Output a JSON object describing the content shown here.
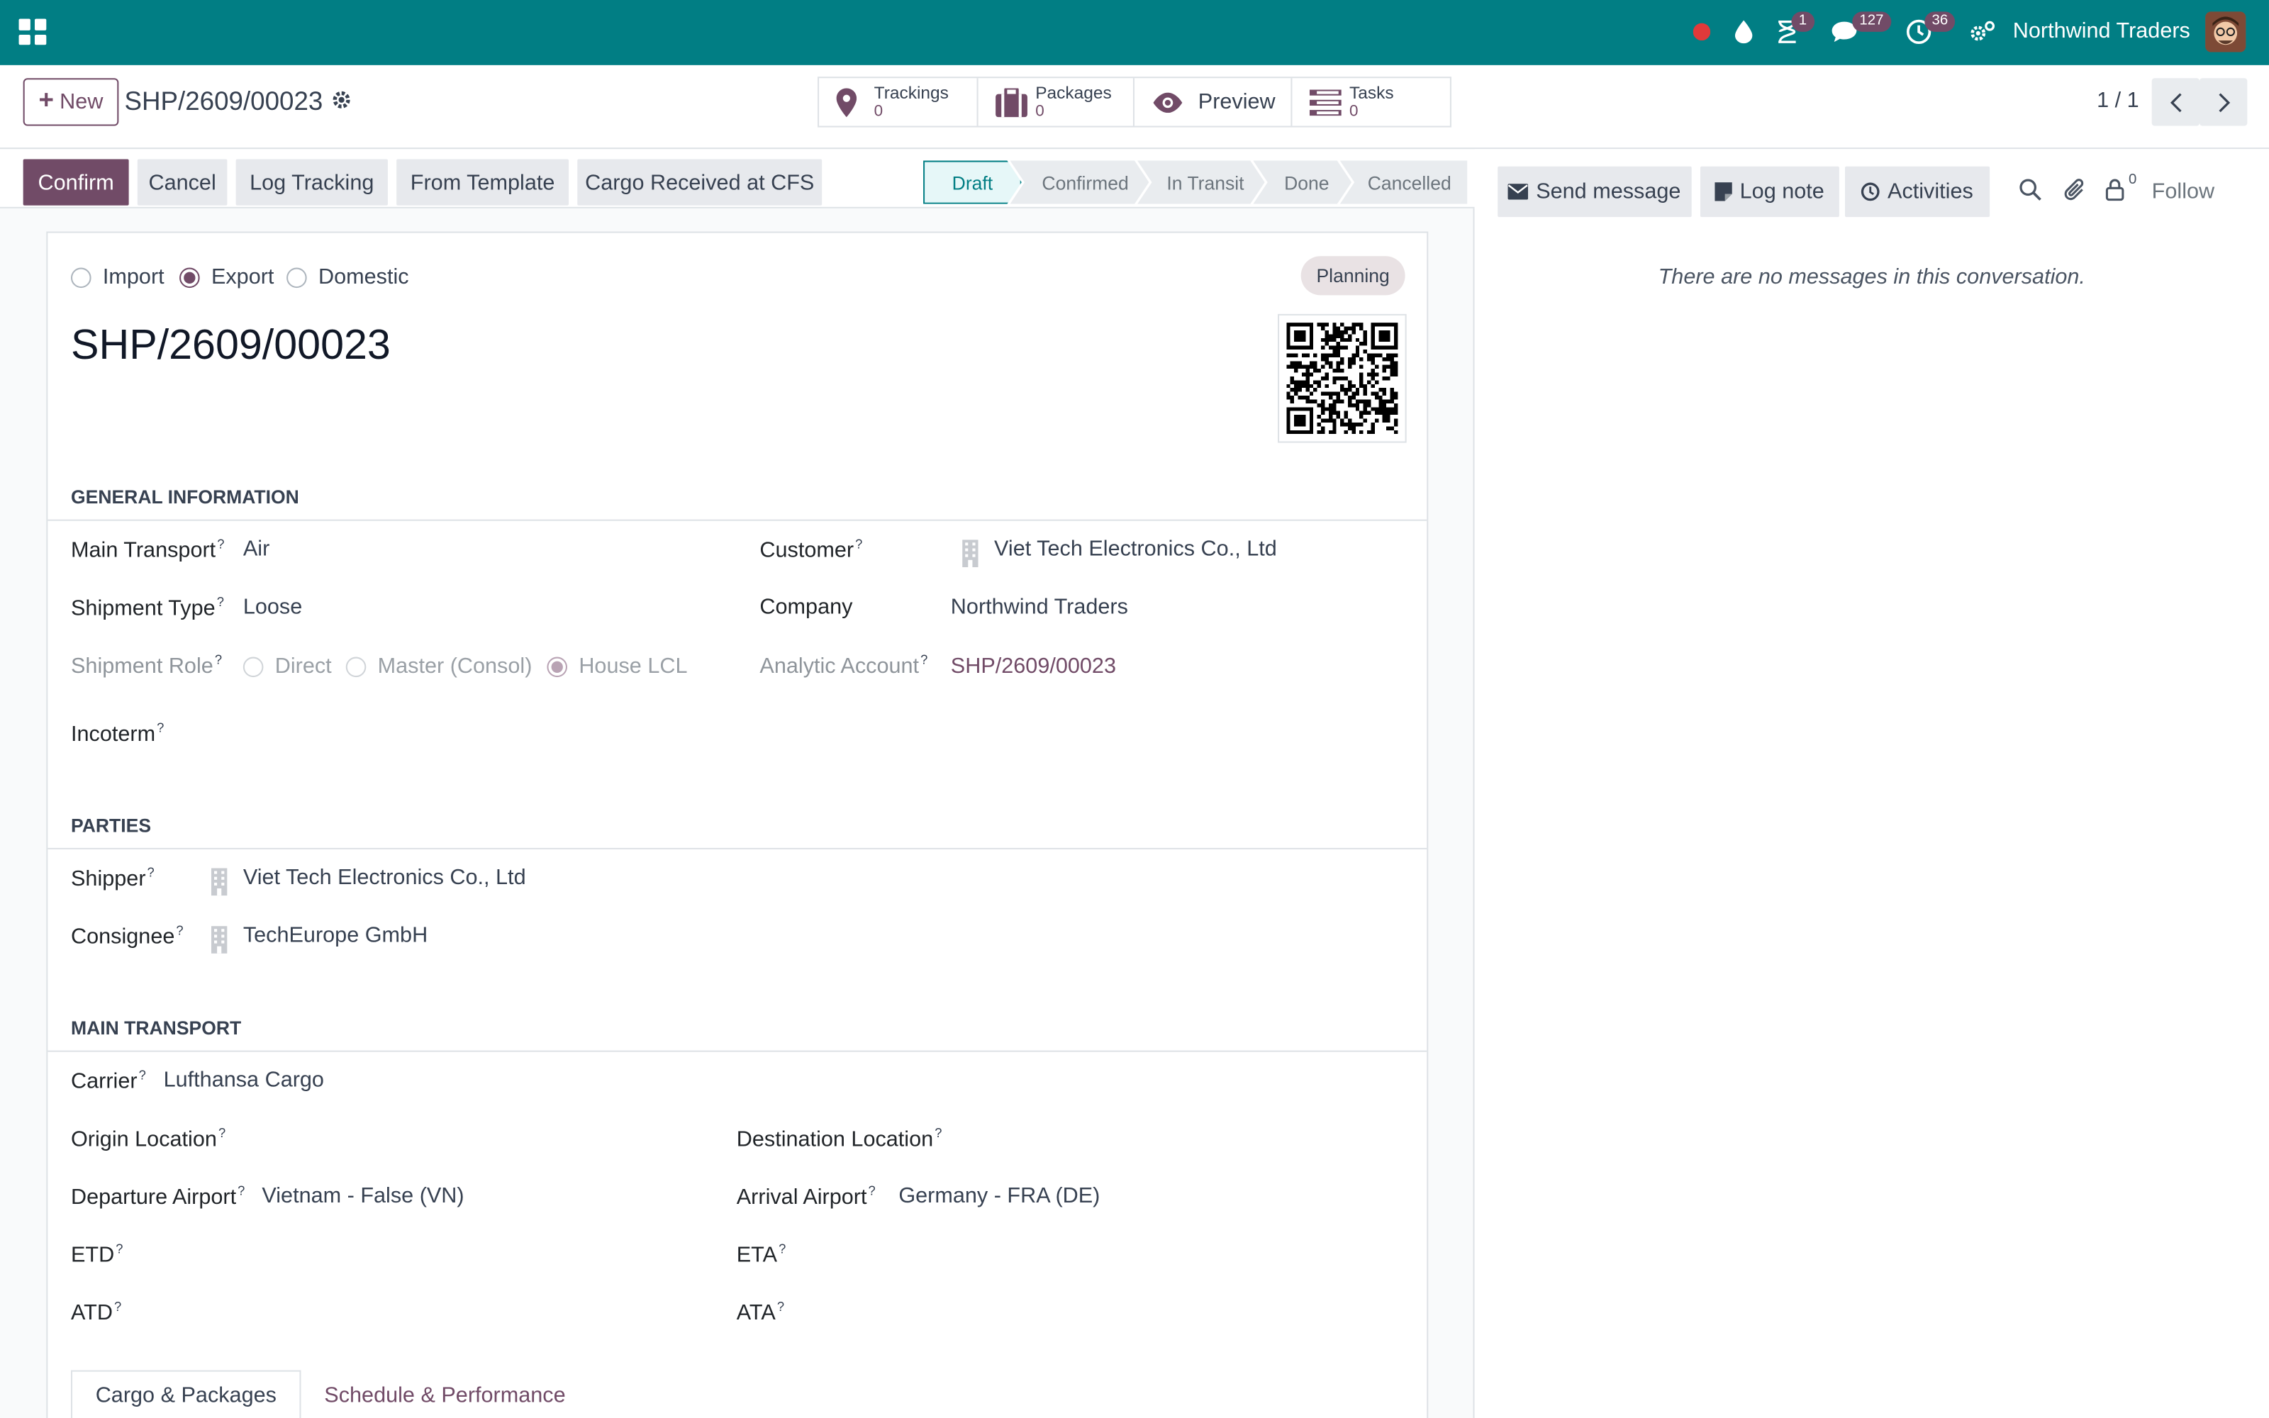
{
  "navbar": {
    "company": "Northwind Traders",
    "activity_badge": "1",
    "messages_badge": "127",
    "clock_badge": "36",
    "icons": [
      "apps-grid-icon",
      "record-dot-icon",
      "droplet-icon",
      "hourglass-icon",
      "chat-icon",
      "clock-icon",
      "settings-icon",
      "avatar"
    ]
  },
  "control_panel": {
    "new_label": "New",
    "breadcrumb_title": "SHP/2609/00023",
    "smart_buttons": {
      "trackings_label": "Trackings",
      "trackings_count": "0",
      "packages_label": "Packages",
      "packages_count": "0",
      "preview_label": "Preview",
      "tasks_label": "Tasks",
      "tasks_count": "0"
    },
    "pager": "1 / 1"
  },
  "status_bar": {
    "buttons": {
      "confirm": "Confirm",
      "cancel": "Cancel",
      "log_tracking": "Log Tracking",
      "from_template": "From Template",
      "cargo_received": "Cargo Received at CFS"
    },
    "stages": {
      "draft": "Draft",
      "confirmed": "Confirmed",
      "in_transit": "In Transit",
      "done": "Done",
      "cancelled": "Cancelled"
    },
    "current_stage": "Draft"
  },
  "form": {
    "direction": {
      "import": "Import",
      "export": "Export",
      "domestic": "Domestic",
      "selected": "Export"
    },
    "tag": "Planning",
    "title": "SHP/2609/00023",
    "sections": {
      "general": "GENERAL INFORMATION",
      "parties": "PARTIES",
      "main_transport": "MAIN TRANSPORT"
    },
    "general": {
      "main_transport_label": "Main Transport",
      "main_transport_value": "Air",
      "shipment_type_label": "Shipment Type",
      "shipment_type_value": "Loose",
      "shipment_role_label": "Shipment Role",
      "role_direct": "Direct",
      "role_master": "Master (Consol)",
      "role_house": "House LCL",
      "incoterm_label": "Incoterm",
      "customer_label": "Customer",
      "customer_value": "Viet Tech Electronics Co., Ltd",
      "company_label": "Company",
      "company_value": "Northwind Traders",
      "analytic_label": "Analytic Account",
      "analytic_value": "SHP/2609/00023"
    },
    "parties": {
      "shipper_label": "Shipper",
      "shipper_value": "Viet Tech Electronics Co., Ltd",
      "consignee_label": "Consignee",
      "consignee_value": "TechEurope GmbH"
    },
    "transport": {
      "carrier_label": "Carrier",
      "carrier_value": "Lufthansa Cargo",
      "origin_label": "Origin Location",
      "destination_label": "Destination Location",
      "departure_label": "Departure Airport",
      "departure_value": "Vietnam - False (VN)",
      "arrival_label": "Arrival Airport",
      "arrival_value": "Germany - FRA (DE)",
      "etd_label": "ETD",
      "eta_label": "ETA",
      "atd_label": "ATD",
      "ata_label": "ATA"
    },
    "tabs": {
      "cargo": "Cargo & Packages",
      "schedule": "Schedule & Performance"
    },
    "help_mark": "?"
  },
  "chatter": {
    "send_message": "Send message",
    "log_note": "Log note",
    "activities": "Activities",
    "followers_count": "0",
    "follow": "Follow",
    "empty": "There are no messages in this conversation."
  },
  "colors": {
    "navbar": "#017e84",
    "primary": "#714b67",
    "stage_active": "#017e84"
  }
}
